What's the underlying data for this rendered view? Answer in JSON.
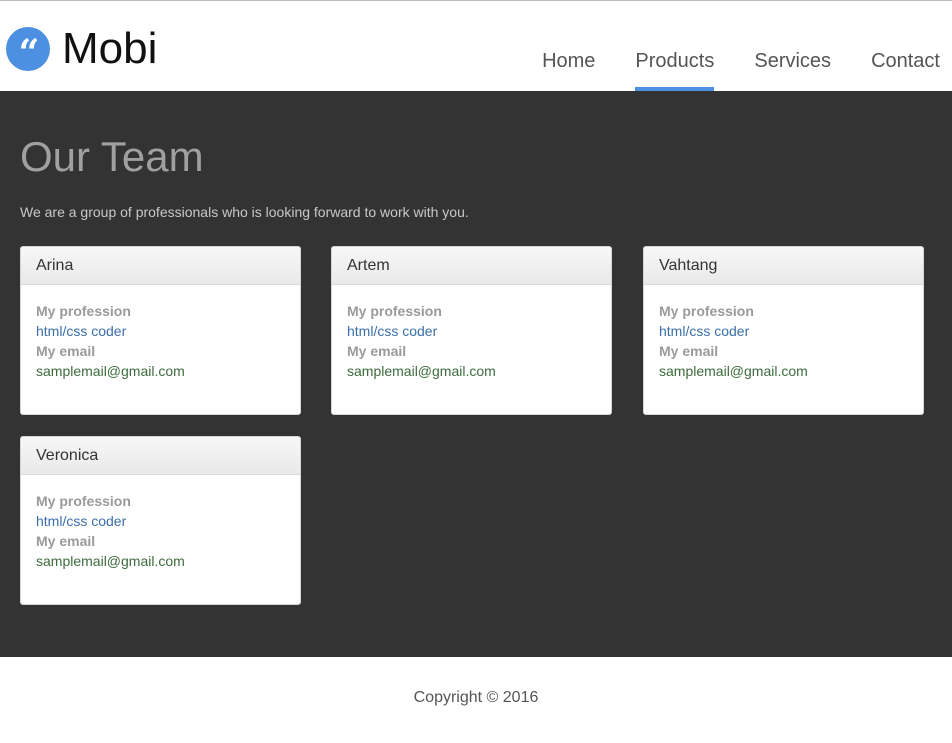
{
  "brand": {
    "logo_icon": "quote-icon",
    "logo_glyph": "“",
    "name": "Mobi",
    "accent_color": "#4d8fe0"
  },
  "nav": {
    "items": [
      {
        "label": "Home",
        "active": false
      },
      {
        "label": "Products",
        "active": true
      },
      {
        "label": "Services",
        "active": false
      },
      {
        "label": "Contact",
        "active": false
      }
    ]
  },
  "team": {
    "title": "Our Team",
    "lead": "We are a group of professionals who is looking forward to work with you.",
    "background_color": "#333333",
    "members": [
      {
        "name": "Arina",
        "profession_label": "My profession",
        "profession": "html/css coder",
        "email_label": "My email",
        "email": "samplemail@gmail.com"
      },
      {
        "name": "Artem",
        "profession_label": "My profession",
        "profession": "html/css coder",
        "email_label": "My email",
        "email": "samplemail@gmail.com"
      },
      {
        "name": "Vahtang",
        "profession_label": "My profession",
        "profession": "html/css coder",
        "email_label": "My email",
        "email": "samplemail@gmail.com"
      },
      {
        "name": "Veronica",
        "profession_label": "My profession",
        "profession": "html/css coder",
        "email_label": "My email",
        "email": "samplemail@gmail.com"
      }
    ]
  },
  "footer": {
    "copyright": "Copyright © 2016"
  }
}
